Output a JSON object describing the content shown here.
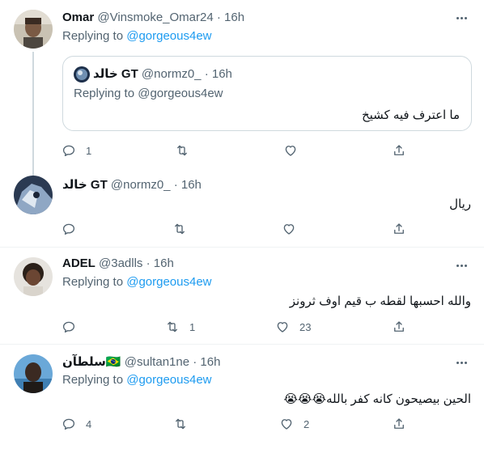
{
  "tweets": [
    {
      "name": "Omar",
      "handle": "@Vinsmoke_Omar24",
      "dot": "·",
      "time": "16h",
      "replying_prefix": "Replying to",
      "replying_to": "@gorgeous4ew",
      "quote": {
        "name": "خالد GT",
        "handle": "@normz0_",
        "dot": "·",
        "time": "16h",
        "replying_prefix": "Replying to",
        "replying_to": "@gorgeous4ew",
        "text": "ما اعترف فيه كشيخ"
      },
      "counts": {
        "reply": "1",
        "retweet": "",
        "like": ""
      }
    },
    {
      "name": "خالد GT",
      "handle": "@normz0_",
      "dot": "·",
      "time": "16h",
      "text": "ريال",
      "counts": {
        "reply": "",
        "retweet": "",
        "like": ""
      }
    },
    {
      "name": "ADEL",
      "handle": "@3adlls",
      "dot": "·",
      "time": "16h",
      "replying_prefix": "Replying to",
      "replying_to": "@gorgeous4ew",
      "text": "والله احسبها لقطه ب قيم اوف ثرونز",
      "counts": {
        "reply": "",
        "retweet": "1",
        "like": "23"
      }
    },
    {
      "name": "سلطآن🇧🇷",
      "handle": "@sultan1ne",
      "dot": "·",
      "time": "16h",
      "replying_prefix": "Replying to",
      "replying_to": "@gorgeous4ew",
      "text": "الحين بيصيحون كانه كفر بالله😭😭😭",
      "counts": {
        "reply": "4",
        "retweet": "",
        "like": "2"
      }
    }
  ],
  "icons": {
    "reply": "reply-icon",
    "retweet": "retweet-icon",
    "like": "like-icon",
    "share": "share-icon",
    "more": "more-icon"
  },
  "colors": {
    "link": "#1d9bf0",
    "muted": "#536471",
    "border": "#cfd9de"
  }
}
